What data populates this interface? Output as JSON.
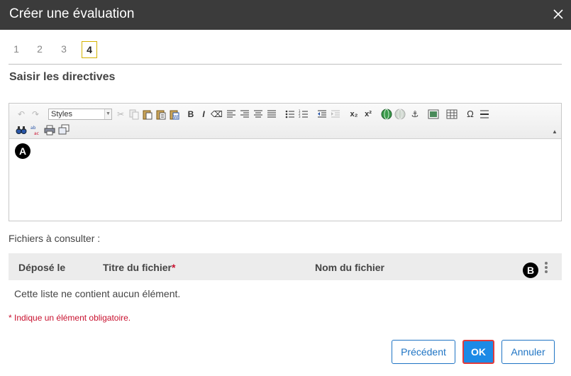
{
  "dialog": {
    "title": "Créer une évaluation"
  },
  "steps": [
    "1",
    "2",
    "3",
    "4"
  ],
  "section_title": "Saisir les directives",
  "editor": {
    "styles_label": "Styles"
  },
  "markers": {
    "a": "A",
    "b": "B"
  },
  "files": {
    "label": "Fichiers à consulter :",
    "columns": {
      "deposited": "Déposé le",
      "title": "Titre du fichier",
      "title_required_mark": "*",
      "filename": "Nom du fichier"
    },
    "empty_message": "Cette liste ne contient aucun élément."
  },
  "required_note": "* Indique un élément obligatoire.",
  "buttons": {
    "previous": "Précédent",
    "ok": "OK",
    "cancel": "Annuler"
  },
  "colors": {
    "titlebar": "#3b3b3b",
    "accent": "#1c8ae6",
    "required": "#c8102e",
    "step_active_border": "#d4b200"
  }
}
